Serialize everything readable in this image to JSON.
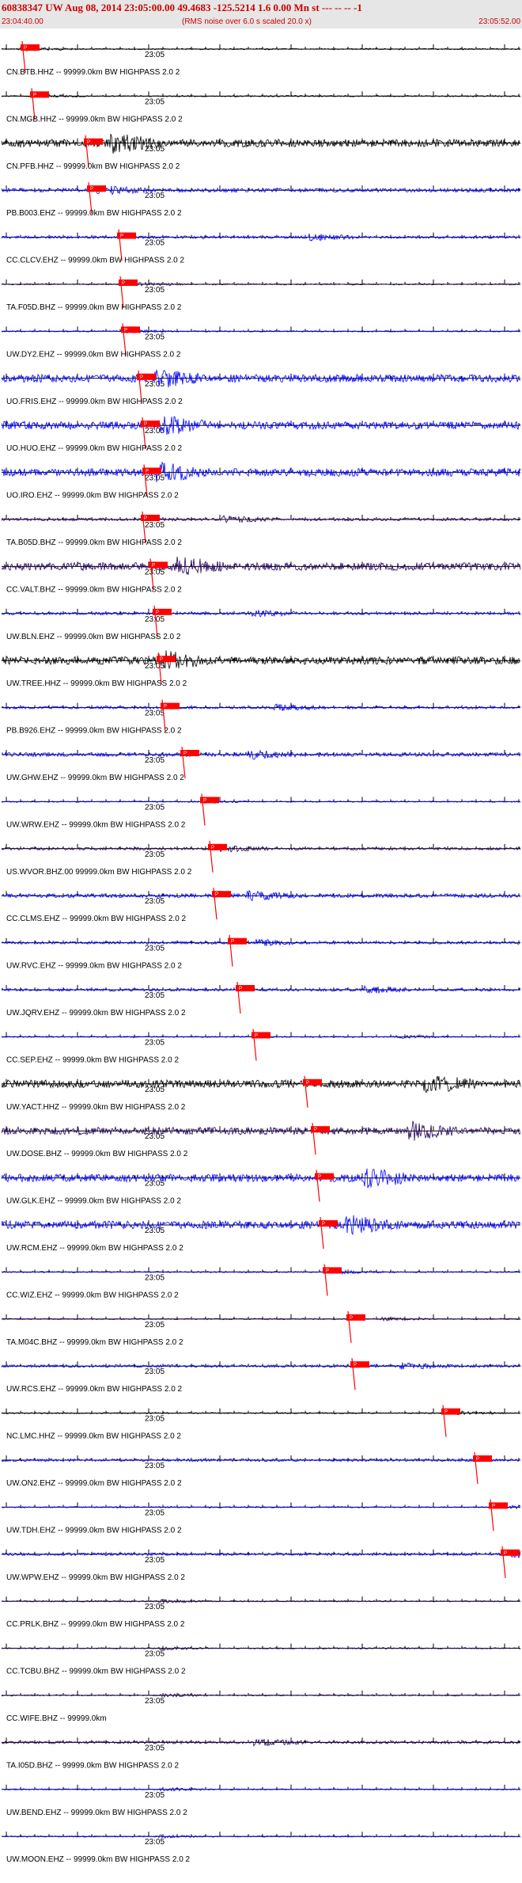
{
  "header": {
    "title": "60838347 UW Aug 08, 2014 23:05:00.00   49.4683 -125.5214  1.6 0.00 Mn st --- -- --   -1",
    "start_time": "23:04:40.00",
    "noise_note": "(RMS noise over 6.0 s scaled 20.0 x)",
    "end_time": "23:05:52.00"
  },
  "colors": {
    "header_bg": "#e6e6e6",
    "header_text": "#cc0000",
    "pick_marker": "#ff0000",
    "trace_black": "#000000",
    "trace_blue": "#0000ff",
    "trace_indigo": "#22005a"
  },
  "minute_mark": "23:05",
  "channels": [
    {
      "label": "CN.BTB.HHZ -- 99999.0km BW  HIGHPASS  2.0  2",
      "color": "black",
      "pick": "P",
      "amp": "quiet"
    },
    {
      "label": "CN.MGB.HHZ -- 99999.0km BW  HIGHPASS  2.0  2",
      "color": "black",
      "pick": "P",
      "amp": "quiet"
    },
    {
      "label": "CN.PFB.HHZ -- 99999.0km BW  HIGHPASS  2.0  2",
      "color": "black",
      "pick": "P",
      "amp": "burst"
    },
    {
      "label": "PB.B003.EHZ -- 99999.0km BW  HIGHPASS  2.0  2",
      "color": "blue",
      "pick": "P",
      "amp": "noisy"
    },
    {
      "label": "CC.CLCV.EHZ -- 99999.0km BW  HIGHPASS  2.0  2",
      "color": "blue",
      "pick": "P",
      "amp": "medium"
    },
    {
      "label": "TA.F05D.BHZ -- 99999.0km BW  HIGHPASS  2.0  2",
      "color": "indigo",
      "pick": "P",
      "amp": "quiet"
    },
    {
      "label": "UW.DY2.EHZ -- 99999.0km BW  HIGHPASS  2.0  2",
      "color": "blue",
      "pick": "P",
      "amp": "quiet"
    },
    {
      "label": "UO.FRIS.EHZ -- 99999.0km BW  HIGHPASS  2.0  2",
      "color": "blue",
      "pick": "P",
      "amp": "burst"
    },
    {
      "label": "UO.HUO.EHZ -- 99999.0km BW  HIGHPASS  2.0  2",
      "color": "blue",
      "pick": "P",
      "amp": "burst"
    },
    {
      "label": "UO.IRO.EHZ -- 99999.0km BW  HIGHPASS  2.0  2",
      "color": "blue",
      "pick": "P",
      "amp": "burst"
    },
    {
      "label": "TA.B05D.BHZ -- 99999.0km BW  HIGHPASS  2.0  2",
      "color": "indigo",
      "pick": "P",
      "amp": "medium"
    },
    {
      "label": "CC.VALT.BHZ -- 99999.0km BW  HIGHPASS  2.0  2",
      "color": "indigo",
      "pick": "P",
      "amp": "burst"
    },
    {
      "label": "UW.BLN.EHZ -- 99999.0km BW  HIGHPASS  2.0  2",
      "color": "blue",
      "pick": "P",
      "amp": "medium"
    },
    {
      "label": "UW.TREE.HHZ -- 99999.0km BW  HIGHPASS  2.0  2",
      "color": "black",
      "pick": "P",
      "amp": "burst"
    },
    {
      "label": "PB.B926.EHZ -- 99999.0km BW  HIGHPASS  2.0  2",
      "color": "blue",
      "pick": "P",
      "amp": "medium"
    },
    {
      "label": "UW.GHW.EHZ -- 99999.0km BW  HIGHPASS  2.0  2",
      "color": "blue",
      "pick": "P",
      "amp": "noisy"
    },
    {
      "label": "UW.WRW.EHZ -- 99999.0km BW  HIGHPASS  2.0  2",
      "color": "blue",
      "pick": "P",
      "amp": "quiet"
    },
    {
      "label": "US.WVOR.BHZ.00 99999.0km BW  HIGHPASS  2.0  2",
      "color": "indigo",
      "pick": "P",
      "amp": "medium"
    },
    {
      "label": "CC.CLMS.EHZ -- 99999.0km BW  HIGHPASS  2.0  2",
      "color": "blue",
      "pick": "P",
      "amp": "noisy"
    },
    {
      "label": "UW.RVC.EHZ -- 99999.0km BW  HIGHPASS  2.0  2",
      "color": "blue",
      "pick": "P",
      "amp": "medium"
    },
    {
      "label": "UW.JQRV.EHZ -- 99999.0km BW  HIGHPASS  2.0  2",
      "color": "blue",
      "pick": "P",
      "amp": "medium"
    },
    {
      "label": "CC.SEP.EHZ -- 99999.0km BW  HIGHPASS  2.0  2",
      "color": "blue",
      "pick": "P",
      "amp": "quiet"
    },
    {
      "label": "UW.YACT.HHZ -- 99999.0km BW  HIGHPASS  2.0  2",
      "color": "black",
      "pick": "P",
      "amp": "burst"
    },
    {
      "label": "UW.DOSE.BHZ -- 99999.0km BW  HIGHPASS  2.0  2",
      "color": "indigo",
      "pick": "P",
      "amp": "burst"
    },
    {
      "label": "UW.GLK.EHZ -- 99999.0km BW  HIGHPASS  2.0  2",
      "color": "blue",
      "pick": "P",
      "amp": "burst"
    },
    {
      "label": "UW.RCM.EHZ -- 99999.0km BW  HIGHPASS  2.0  2",
      "color": "blue",
      "pick": "P",
      "amp": "burst"
    },
    {
      "label": "CC.WIZ.EHZ -- 99999.0km BW  HIGHPASS  2.0  2",
      "color": "blue",
      "pick": "P",
      "amp": "quiet"
    },
    {
      "label": "TA.M04C.BHZ -- 99999.0km BW  HIGHPASS  2.0  2",
      "color": "indigo",
      "pick": "P",
      "amp": "quiet"
    },
    {
      "label": "UW.RCS.EHZ -- 99999.0km BW  HIGHPASS  2.0  2",
      "color": "blue",
      "pick": "P",
      "amp": "medium"
    },
    {
      "label": "NC.LMC.HHZ -- 99999.0km BW  HIGHPASS  2.0  2",
      "color": "black",
      "pick": "P",
      "amp": "quiet"
    },
    {
      "label": "UW.ON2.EHZ -- 99999.0km BW  HIGHPASS  2.0  2",
      "color": "blue",
      "pick": "P",
      "amp": "medium"
    },
    {
      "label": "UW.TDH.EHZ -- 99999.0km BW  HIGHPASS  2.0  2",
      "color": "blue",
      "pick": "P",
      "amp": "quiet"
    },
    {
      "label": "UW.WPW.EHZ -- 99999.0km BW  HIGHPASS  2.0  2",
      "color": "blue",
      "pick": "P",
      "amp": "medium"
    },
    {
      "label": "CC.PRLK.BHZ -- 99999.0km BW  HIGHPASS  2.0  2",
      "color": "indigo",
      "pick": "",
      "amp": "quiet"
    },
    {
      "label": "CC.TCBU.BHZ -- 99999.0km BW  HIGHPASS  2.0  2",
      "color": "indigo",
      "pick": "",
      "amp": "quiet"
    },
    {
      "label": "CC.WIFE.BHZ -- 99999.0km",
      "color": "indigo",
      "pick": "",
      "amp": "quiet"
    },
    {
      "label": "TA.I05D.BHZ -- 99999.0km BW  HIGHPASS  2.0  2",
      "color": "indigo",
      "pick": "",
      "amp": "medium"
    },
    {
      "label": "UW.BEND.EHZ -- 99999.0km BW  HIGHPASS  2.0  2",
      "color": "blue",
      "pick": "",
      "amp": "quiet"
    },
    {
      "label": "UW.MOON.EHZ -- 99999.0km BW  HIGHPASS  2.0  2",
      "color": "blue",
      "pick": "",
      "amp": "quiet"
    }
  ]
}
